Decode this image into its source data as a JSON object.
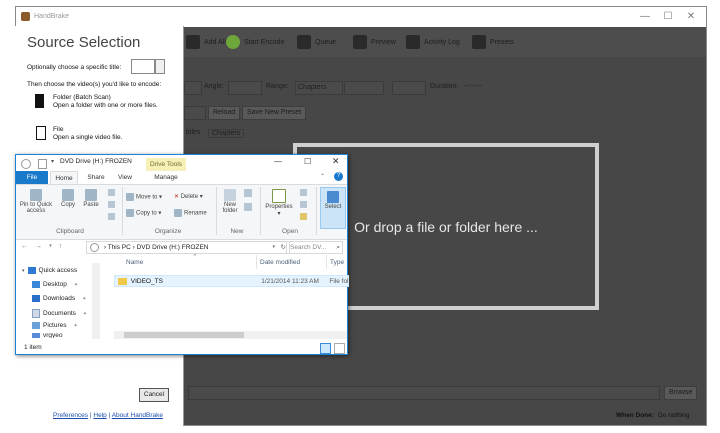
{
  "app": {
    "title": "HandBrake",
    "window_controls": [
      "—",
      "☐",
      "✕"
    ]
  },
  "toolbar": {
    "add_all": "Add All",
    "start_encode": "Start Encode",
    "queue": "Queue",
    "preview": "Preview",
    "activity_log": "Activity Log",
    "presets": "Presets"
  },
  "row1": {
    "angle_label": "Angle:",
    "range_label": "Range:",
    "range_value": "Chapters",
    "duration_label": "Duration:",
    "duration_value": "--:--:--"
  },
  "row2": {
    "reload": "Reload",
    "save_new_preset": "Save New Preset"
  },
  "tabs": {
    "subtitles_partial": "titles",
    "chapters": "Chapters"
  },
  "drop_zone": {
    "text": "Or drop a file or folder here ..."
  },
  "bottom": {
    "browse": "Browse",
    "when_done_label": "When Done:",
    "when_done_value": "Do nothing"
  },
  "source_selection": {
    "title": "Source Selection",
    "choose_title_label": "Optionally choose a specific title:",
    "choose_video_label": "Then choose the video(s) you'd like to encode:",
    "folder_title": "Folder (Batch Scan)",
    "folder_desc": "Open a folder with one or more files.",
    "file_title": "File",
    "file_desc": "Open a single video file.",
    "cancel": "Cancel",
    "links": {
      "preferences": "Preferences",
      "help": "Help",
      "about": "About HandBrake",
      "sep": "|"
    }
  },
  "explorer": {
    "title": "DVD Drive (H:) FROZEN",
    "drive_tools": "Drive Tools",
    "tabs": {
      "file": "File",
      "home": "Home",
      "share": "Share",
      "view": "View",
      "manage": "Manage"
    },
    "ribbon": {
      "pin": "Pin to Quick access",
      "copy": "Copy",
      "paste": "Paste",
      "move_to": "Move to",
      "copy_to": "Copy to",
      "delete": "Delete",
      "rename": "Rename",
      "new_folder": "New folder",
      "properties": "Properties",
      "select": "Select",
      "groups": {
        "clipboard": "Clipboard",
        "organize": "Organize",
        "new": "New",
        "open": "Open"
      }
    },
    "address": {
      "this_pc": "This PC",
      "sep": "›",
      "drive": "DVD Drive (H:) FROZEN"
    },
    "search_placeholder": "Search DV...",
    "nav": {
      "quick_access": "Quick access",
      "desktop": "Desktop",
      "downloads": "Downloads",
      "documents": "Documents",
      "pictures": "Pictures",
      "videos": "vrgyeo"
    },
    "columns": {
      "name": "Name",
      "date": "Date modified",
      "type": "Type"
    },
    "files": [
      {
        "name": "VIDEO_TS",
        "date": "1/21/2014 11:23 AM",
        "type": "File fol"
      }
    ],
    "status": "1 item"
  },
  "colors": {
    "hb_background": "#474747",
    "explorer_accent": "#1979ca",
    "drive_tools_bg": "#f7f0b6",
    "link": "#1a4fb0"
  }
}
